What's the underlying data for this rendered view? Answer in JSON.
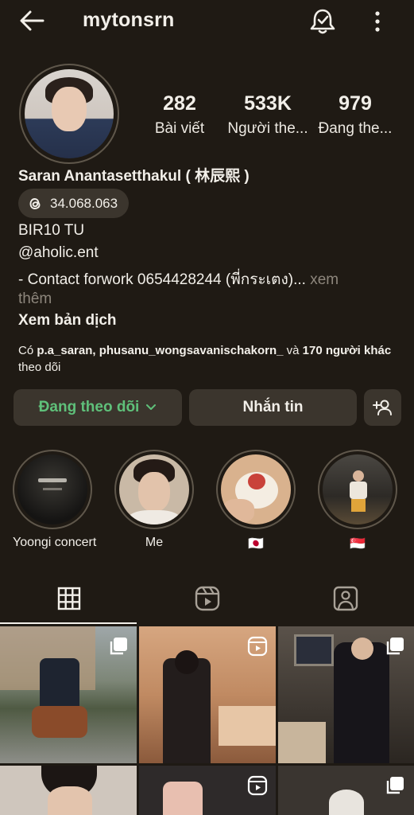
{
  "header": {
    "username": "mytonsrn"
  },
  "profile": {
    "stats": [
      {
        "value": "282",
        "label": "Bài viết"
      },
      {
        "value": "533K",
        "label": "Người the..."
      },
      {
        "value": "979",
        "label": "Đang the..."
      }
    ],
    "full_name": "Saran Anantasetthakul ( 林辰熙 )",
    "threads_count": "34.068.063",
    "bio": {
      "line1": "BIR10 TU",
      "line2": "@aholic.ent",
      "line3": "- Contact forwork  0654428244 (พี่กระเตง)...",
      "more_label": " xem",
      "more_label2": "thêm"
    },
    "translate_label": "Xem bản dịch",
    "followed_by": {
      "prefix": "Có ",
      "names": "p.a_saran, phusanu_wongsavanischakorn_",
      "middle": " và ",
      "others": "170 người khác",
      "suffix": " theo dõi"
    }
  },
  "actions": {
    "following_label": "Đang theo dõi",
    "message_label": "Nhắn tin"
  },
  "highlights": [
    {
      "label": "Yoongi concert"
    },
    {
      "label": "Me"
    },
    {
      "label": "🇯🇵"
    },
    {
      "label": "🇸🇬"
    }
  ],
  "tabs": {
    "active": "grid"
  },
  "colors": {
    "background": "#1f1a14",
    "button_bg": "#3b352d",
    "following_green": "#5fc07a",
    "muted_text": "#8d867c"
  }
}
